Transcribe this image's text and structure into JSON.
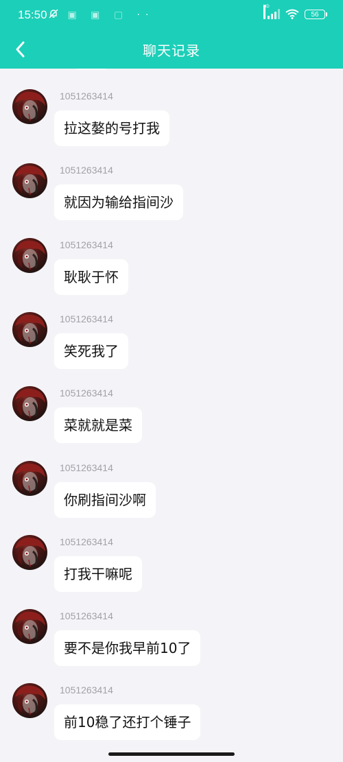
{
  "status": {
    "time": "15:50",
    "left_icons": [
      "bell-off-icon",
      "notification-icon",
      "notification-icon",
      "notification-icon",
      "more-dots-icon"
    ],
    "network_label": "HD",
    "battery": "56"
  },
  "header": {
    "title": "聊天记录",
    "back_icon": "chevron-left-icon",
    "background": "#1ccfb8"
  },
  "messages": [
    {
      "sender": "1051263414",
      "text": "拉这嫯的号打我"
    },
    {
      "sender": "1051263414",
      "text": "就因为输给指间沙"
    },
    {
      "sender": "1051263414",
      "text": "耿耿于怀"
    },
    {
      "sender": "1051263414",
      "text": "笑死我了"
    },
    {
      "sender": "1051263414",
      "text": "菜就就是菜"
    },
    {
      "sender": "1051263414",
      "text": "你刷指间沙啊"
    },
    {
      "sender": "1051263414",
      "text": "打我干嘛呢"
    },
    {
      "sender": "1051263414",
      "text": "要不是你我早前10了"
    },
    {
      "sender": "1051263414",
      "text": "前10稳了还打个锤子"
    }
  ]
}
